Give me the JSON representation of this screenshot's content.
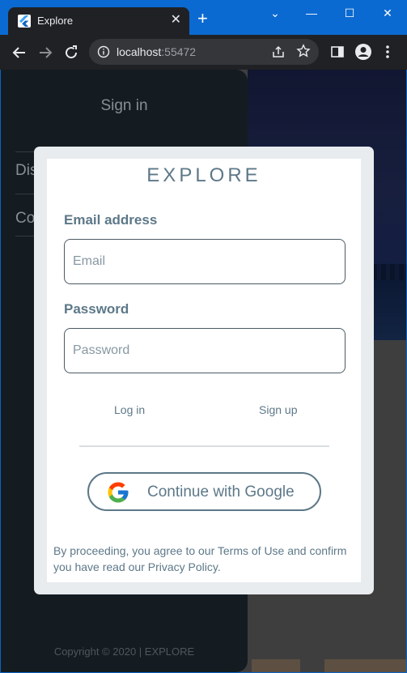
{
  "browser": {
    "tab_title": "Explore",
    "close_tab": "✕",
    "new_tab": "+",
    "minimize": "—",
    "maximize": "☐",
    "close_window": "✕",
    "chevron": "⌄",
    "url_host": "localhost",
    "url_port": ":55472",
    "icons": [
      "back-arrow-icon",
      "forward-arrow-icon",
      "reload-icon",
      "site-info-icon",
      "share-icon",
      "bookmark-star-icon",
      "side-panel-icon",
      "profile-icon",
      "more-menu-icon"
    ]
  },
  "drawer": {
    "title": "Sign in",
    "items": [
      {
        "label": "Dis"
      },
      {
        "label": "Co"
      }
    ],
    "copyright": "Copyright © 2020 | EXPLORE"
  },
  "modal": {
    "brand": "EXPLORE",
    "email_label": "Email address",
    "email_placeholder": "Email",
    "email_value": "",
    "password_label": "Password",
    "password_placeholder": "Password",
    "password_value": "",
    "login_label": "Log in",
    "signup_label": "Sign up",
    "google_label": "Continue with Google",
    "legal_text": "By proceeding, you agree to our Terms of Use and confirm you have read our Privacy Policy."
  },
  "colors": {
    "accent": "#5d7888",
    "drawer_bg": "#172026",
    "modal_bg": "#e8ecef",
    "titlebar": "#0b6ad1"
  }
}
